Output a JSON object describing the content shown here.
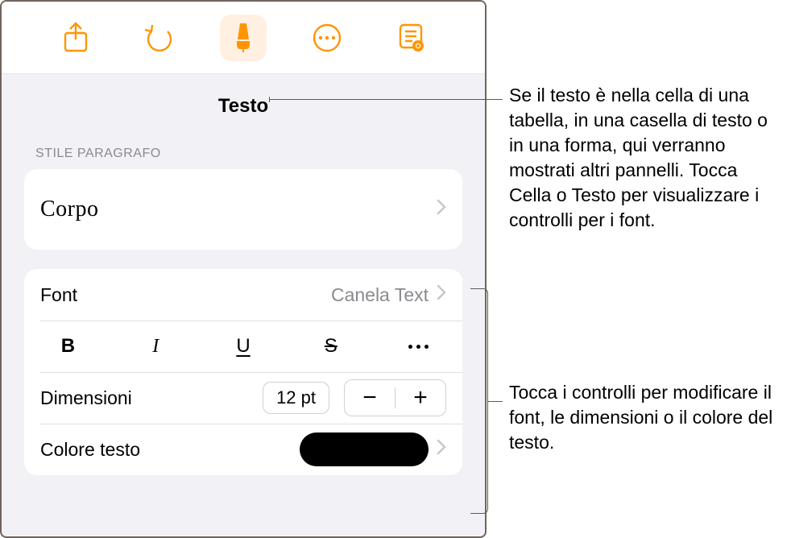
{
  "toolbar": {
    "icons": [
      "share-icon",
      "undo-icon",
      "brush-icon",
      "more-icon",
      "read-mode-icon"
    ],
    "active_index": 2
  },
  "header": {
    "title": "Testo"
  },
  "paragraph_style": {
    "section_label": "STILE PARAGRAFO",
    "current": "Corpo"
  },
  "font": {
    "label": "Font",
    "value": "Canela Text",
    "style_glyphs": {
      "bold": "B",
      "italic": "I",
      "underline": "U",
      "strike": "S"
    }
  },
  "size": {
    "label": "Dimensioni",
    "value": "12 pt",
    "minus": "−",
    "plus": "+"
  },
  "text_color": {
    "label": "Colore testo",
    "swatch_hex": "#000000"
  },
  "callouts": {
    "top": "Se il testo è nella cella di una tabella, in una casella di testo o in una forma, qui verranno mostrati altri pannelli. Tocca Cella o Testo per visualizzare i controlli per i font.",
    "bottom": "Tocca i controlli per modificare il font, le dimensioni o il colore del testo."
  }
}
